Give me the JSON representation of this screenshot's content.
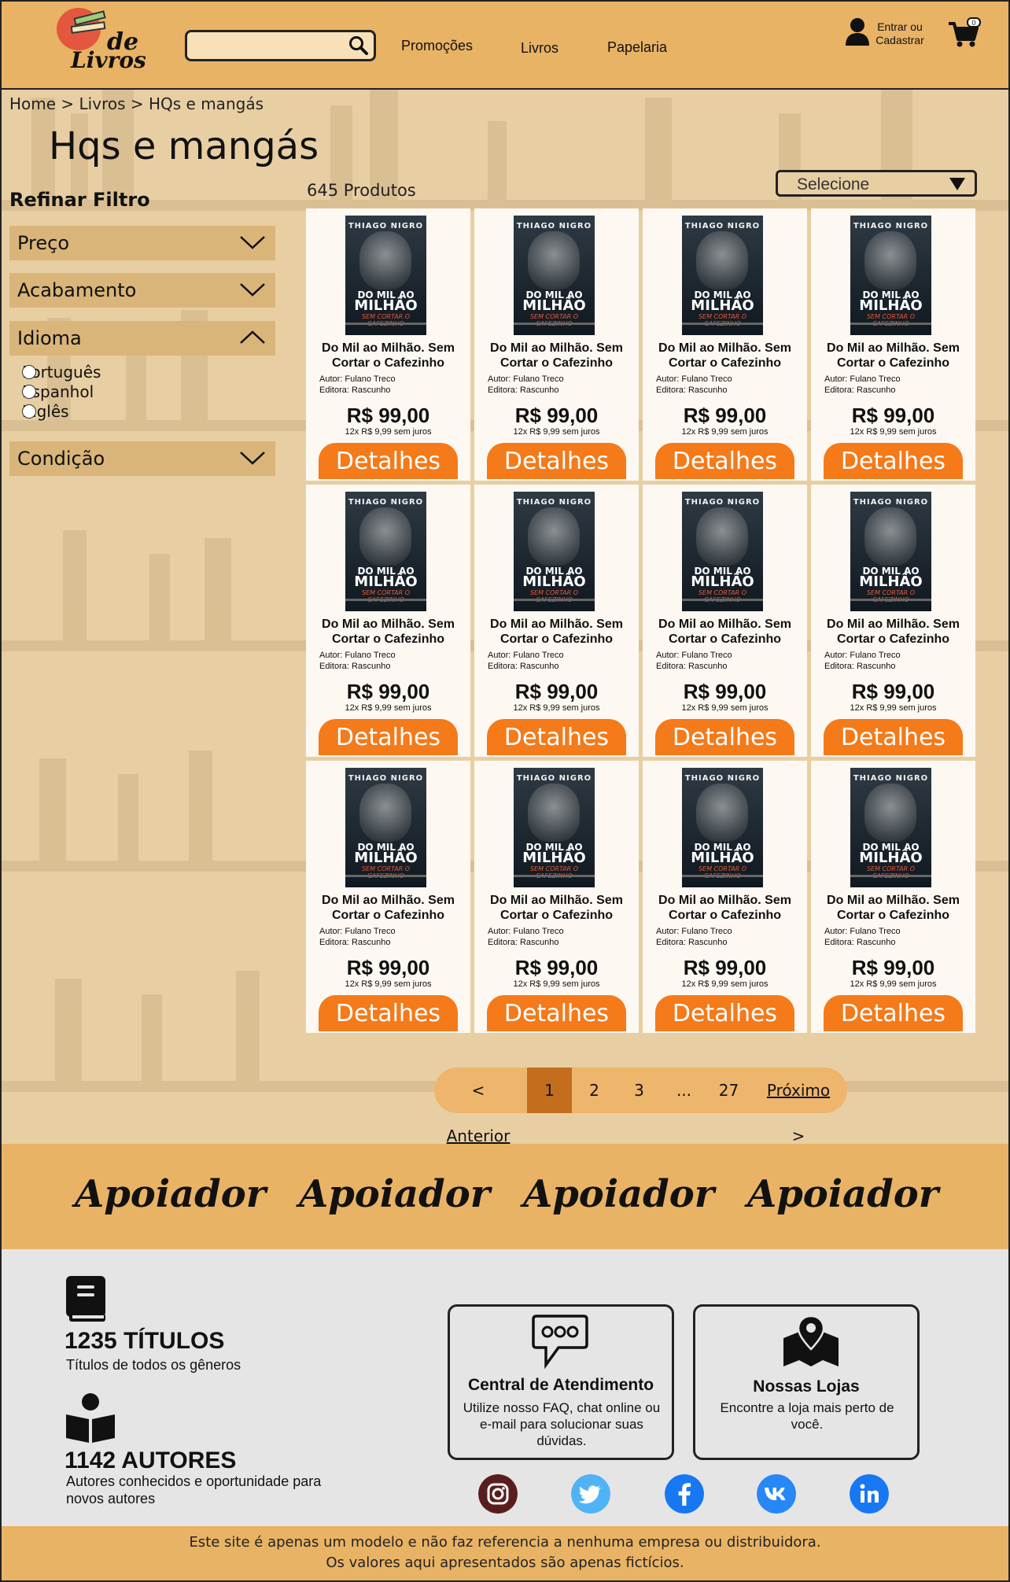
{
  "header": {
    "logo_line1": "de",
    "logo_line2": "Livros",
    "search_placeholder": "",
    "nav": [
      "Promoções",
      "Livros",
      "Papelaria"
    ],
    "account_label": "Entrar ou Cadastrar",
    "cart_count": "0"
  },
  "breadcrumb": "Home > Livros > HQs e mangás",
  "page_title": "Hqs e mangás",
  "filters": {
    "title": "Refinar Filtro",
    "facets": [
      {
        "label": "Preço",
        "expanded": false
      },
      {
        "label": "Acabamento",
        "expanded": false
      },
      {
        "label": "Idioma",
        "expanded": true,
        "options": [
          "Português",
          "Espanhol",
          "Inglês"
        ]
      },
      {
        "label": "Condição",
        "expanded": false
      }
    ]
  },
  "products_count": "645 Produtos",
  "sort": {
    "selected": "Selecione"
  },
  "product": {
    "cover_author": "THIAGO NIGRO",
    "cover_title_small": "DO MIL AO",
    "cover_title_big": "MILHÃO",
    "cover_subtitle": "SEM CORTAR O CAFEZINHO",
    "title": "Do Mil ao Milhão. Sem Cortar o Cafezinho",
    "author": "Autor: Fulano Treco",
    "publisher": "Editora: Rascunho",
    "price": "R$ 99,00",
    "installments": "12x R$ 9,99 sem juros",
    "button": "Detalhes"
  },
  "products_grid": {
    "rows": 3,
    "cols": 4
  },
  "pagination": {
    "prev": "Anterior",
    "pages": [
      "1",
      "2",
      "3",
      "...",
      "27"
    ],
    "current": "1",
    "next": "Próximo"
  },
  "sponsors": [
    "Apoiador",
    "Apoiador",
    "Apoiador",
    "Apoiador"
  ],
  "stats": [
    {
      "number": "1235 TÍTULOS",
      "desc": "Títulos de todos os gêneros"
    },
    {
      "number": "1142 AUTORES",
      "desc": "Autores conhecidos e oportunidade para novos autores"
    }
  ],
  "boxes": [
    {
      "title": "Central de Atendimento",
      "desc": "Utilize nosso FAQ, chat online ou e-mail para solucionar suas dúvidas."
    },
    {
      "title": "Nossas Lojas",
      "desc": "Encontre a loja mais perto de você."
    }
  ],
  "social": [
    {
      "icon": "instagram-icon",
      "color": "#5a1d1d"
    },
    {
      "icon": "twitter-icon",
      "color": "#1da1f2"
    },
    {
      "icon": "facebook-icon",
      "color": "#1877f2"
    },
    {
      "icon": "vk-icon",
      "color": "#2787f5"
    },
    {
      "icon": "linkedin-icon",
      "color": "#1877f2"
    }
  ],
  "footer": {
    "line1": "Este site é apenas um modelo e não faz referencia a nenhuma empresa ou distribuidora.",
    "line2": "Os valores aqui apresentados são apenas fictícios."
  },
  "colors": {
    "header": "#e9b365",
    "page": "#e8cfa3",
    "button": "#f47a1a",
    "facet": "#d9b57a"
  }
}
